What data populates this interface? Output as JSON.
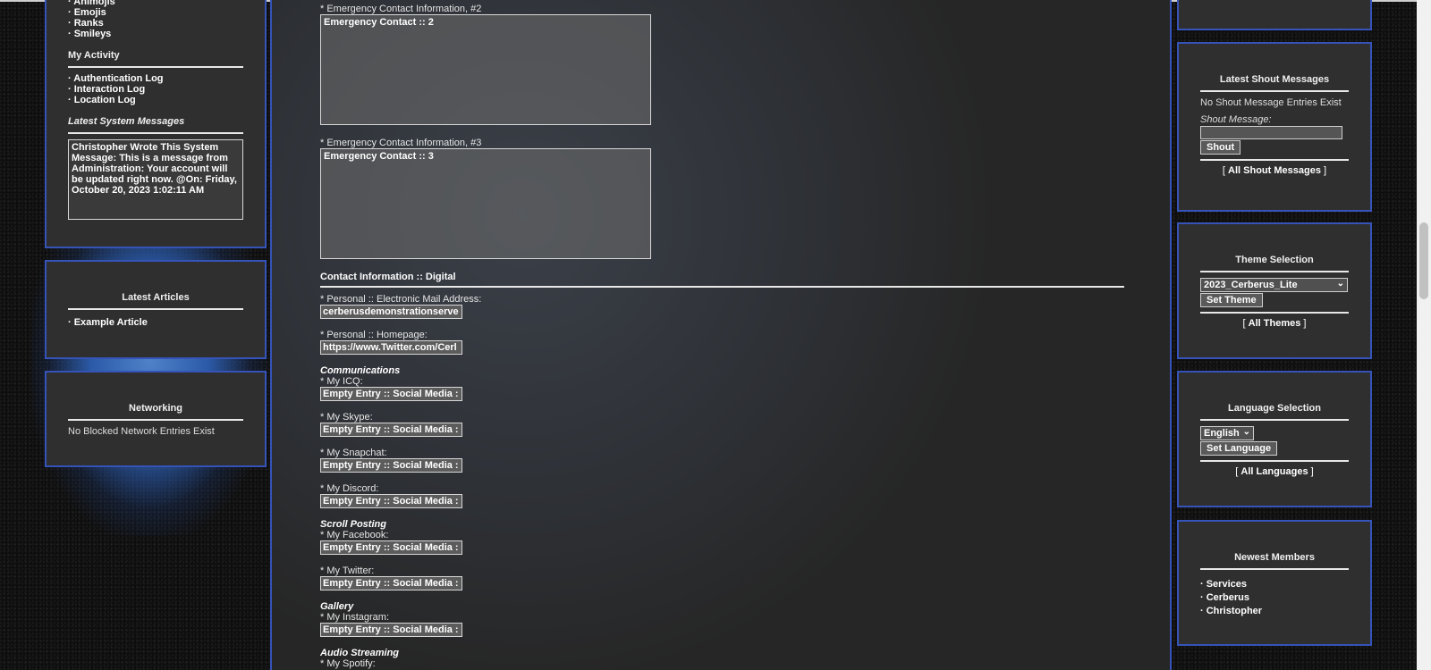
{
  "left": {
    "top_items": [
      "· Animojis",
      "· Emojis",
      "· Ranks",
      "· Smileys"
    ],
    "activity_title": "My Activity",
    "activity_items": [
      "· Authentication Log",
      "· Interaction Log",
      "· Location Log"
    ],
    "system_messages_title": "Latest System Messages",
    "system_message_text": "Christopher Wrote This System Message: This is a message from Administration: Your account will be updated right now. @On: Friday, October 20, 2023 1:02:11 AM",
    "articles_title": "Latest Articles",
    "articles_items": [
      "· Example Article"
    ],
    "networking_title": "Networking",
    "networking_text": "No Blocked Network Entries Exist"
  },
  "main": {
    "emergency2_label": "* Emergency Contact Information, #2",
    "emergency2_value": "Emergency Contact :: 2",
    "emergency3_label": "* Emergency Contact Information, #3",
    "emergency3_value": "Emergency Contact :: 3",
    "digital_title": "Contact Information :: Digital",
    "email_label": "* Personal :: Electronic Mail Address:",
    "email_value": "cerberusdemonstrationserve",
    "homepage_label": "* Personal :: Homepage:",
    "homepage_value": "https://www.Twitter.com/Cerl",
    "comm_head": "Communications",
    "icq_label": "* My ICQ:",
    "skype_label": "* My Skype:",
    "snapchat_label": "* My Snapchat:",
    "discord_label": "* My Discord:",
    "scroll_head": "Scroll Posting",
    "facebook_label": "* My Facebook:",
    "twitter_label": "* My Twitter:",
    "gallery_head": "Gallery",
    "instagram_label": "* My Instagram:",
    "audio_head": "Audio Streaming",
    "spotify_label": "* My Spotify:",
    "empty_value": "Empty Entry :: Social Media :"
  },
  "right": {
    "shout_title": "Latest Shout Messages",
    "shout_empty": "No Shout Message Entries Exist",
    "shout_label": "Shout Message:",
    "shout_button": "Shout",
    "shout_all_prefix": "[ ",
    "shout_all_link": "All Shout Messages",
    "shout_all_suffix": " ]",
    "theme_title": "Theme Selection",
    "theme_selected": "2023_Cerberus_Lite",
    "theme_button": "Set Theme",
    "theme_all_link": "All Themes",
    "language_title": "Language Selection",
    "language_selected": "English",
    "language_button": "Set Language",
    "language_all_link": "All Languages",
    "members_title": "Newest Members",
    "members": [
      "· Services",
      "· Cerberus",
      "· Christopher"
    ]
  },
  "colors": {
    "panel_border": "#3553b8",
    "panel_bg": "#2f2f2f"
  }
}
